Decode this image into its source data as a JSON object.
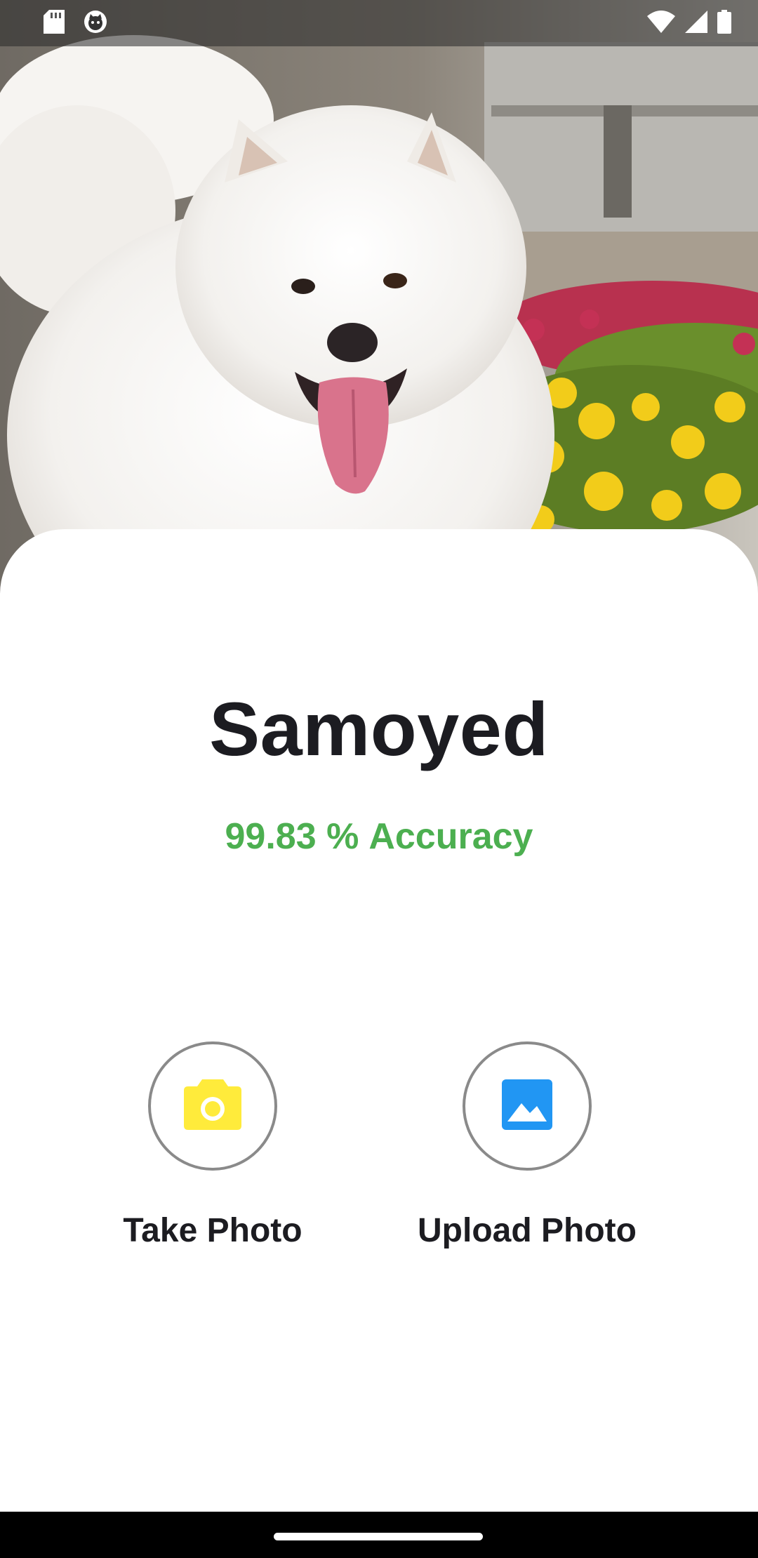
{
  "status_bar": {
    "left_icons": [
      "sd-card-icon",
      "cat-face-icon"
    ],
    "right_icons": [
      "wifi-icon",
      "cellular-signal-icon",
      "battery-icon"
    ]
  },
  "hero": {
    "image": "samoyed-dog-photo"
  },
  "result": {
    "breed": "Samoyed",
    "accuracy_value": "99.83 %",
    "accuracy_label": "Accuracy"
  },
  "actions": {
    "take_photo": {
      "label": "Take Photo",
      "icon": "camera-icon",
      "icon_color": "#ffeb3b"
    },
    "upload_photo": {
      "label": "Upload Photo",
      "icon": "image-icon",
      "icon_color": "#2196f3"
    }
  },
  "colors": {
    "accuracy": "#4caf50",
    "text": "#1c1c21",
    "circle_border": "#8a8a8a"
  }
}
